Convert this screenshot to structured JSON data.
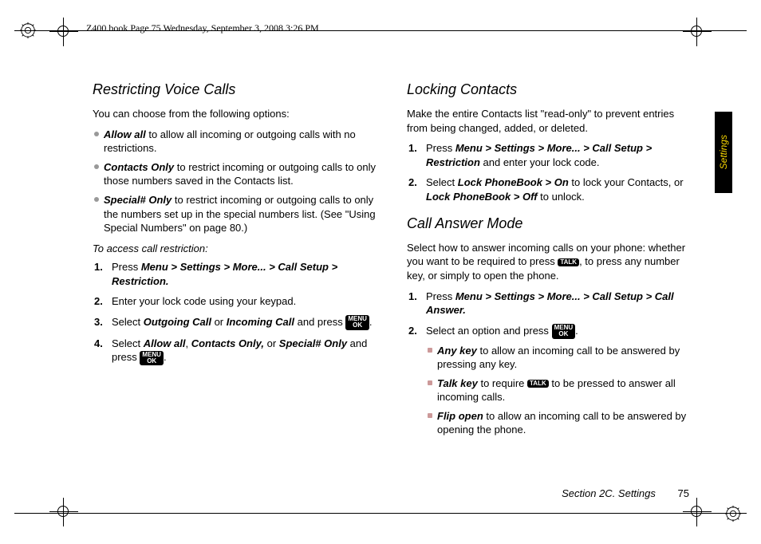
{
  "meta": {
    "header_line": "Z400.book  Page 75  Wednesday, September 3, 2008  3:26 PM",
    "side_tab": "Settings",
    "footer_section": "Section 2C. Settings",
    "footer_page": "75"
  },
  "keys": {
    "menu_ok_line1": "MENU",
    "menu_ok_line2": "OK",
    "talk": "TALK"
  },
  "left": {
    "h1": "Restricting Voice Calls",
    "intro": "You can choose from the following options:",
    "bullets": [
      {
        "b": "Allow all",
        "t": " to allow all incoming or outgoing calls with no restrictions."
      },
      {
        "b": "Contacts Only",
        "t": " to restrict incoming or outgoing calls to only those numbers saved in the Contacts list."
      },
      {
        "b": "Special# Only",
        "t": " to restrict incoming or outgoing calls to only the numbers set up in the special numbers list. (See \"Using Special Numbers\" on page 80.)"
      }
    ],
    "caption": "To access call restriction:",
    "steps": {
      "s1_a": "Press ",
      "s1_b": "Menu > Settings > More... > Call Setup > Restriction.",
      "s2": "Enter your lock code using your keypad.",
      "s3_a": "Select ",
      "s3_b": "Outgoing Call",
      "s3_c": " or ",
      "s3_d": "Incoming Call",
      "s3_e": " and press ",
      "s3_f": ".",
      "s4_a": "Select ",
      "s4_b": "Allow all",
      "s4_c": ", ",
      "s4_d": "Contacts Only,",
      "s4_e": " or ",
      "s4_f": "Special# Only",
      "s4_g": " and press ",
      "s4_h": "."
    }
  },
  "right": {
    "h1": "Locking Contacts",
    "intro": "Make the entire Contacts list \"read-only\" to prevent entries from being changed, added, or deleted.",
    "steps1": {
      "s1_a": "Press ",
      "s1_b": "Menu > Settings > More... > Call Setup > Restriction",
      "s1_c": " and enter your lock code.",
      "s2_a": "Select ",
      "s2_b": "Lock PhoneBook > On",
      "s2_c": " to lock your Contacts, or ",
      "s2_d": "Lock PhoneBook > Off",
      "s2_e": " to unlock."
    },
    "h2": "Call Answer Mode",
    "intro2_a": "Select how to answer incoming calls on your phone: whether you want to be required to press ",
    "intro2_b": ", to press any number key, or simply to open the phone.",
    "steps2": {
      "s1_a": "Press ",
      "s1_b": "Menu > Settings > More... > Call Setup > Call Answer.",
      "s2_a": "Select an option and press ",
      "s2_b": "."
    },
    "subbullets": [
      {
        "b": "Any key",
        "t": " to allow an incoming call to be answered by pressing any key."
      },
      {
        "b": "Talk key",
        "t_a": " to require ",
        "t_b": " to be pressed to answer all incoming calls."
      },
      {
        "b": "Flip open",
        "t": " to allow an incoming call to be answered by opening the phone."
      }
    ]
  }
}
